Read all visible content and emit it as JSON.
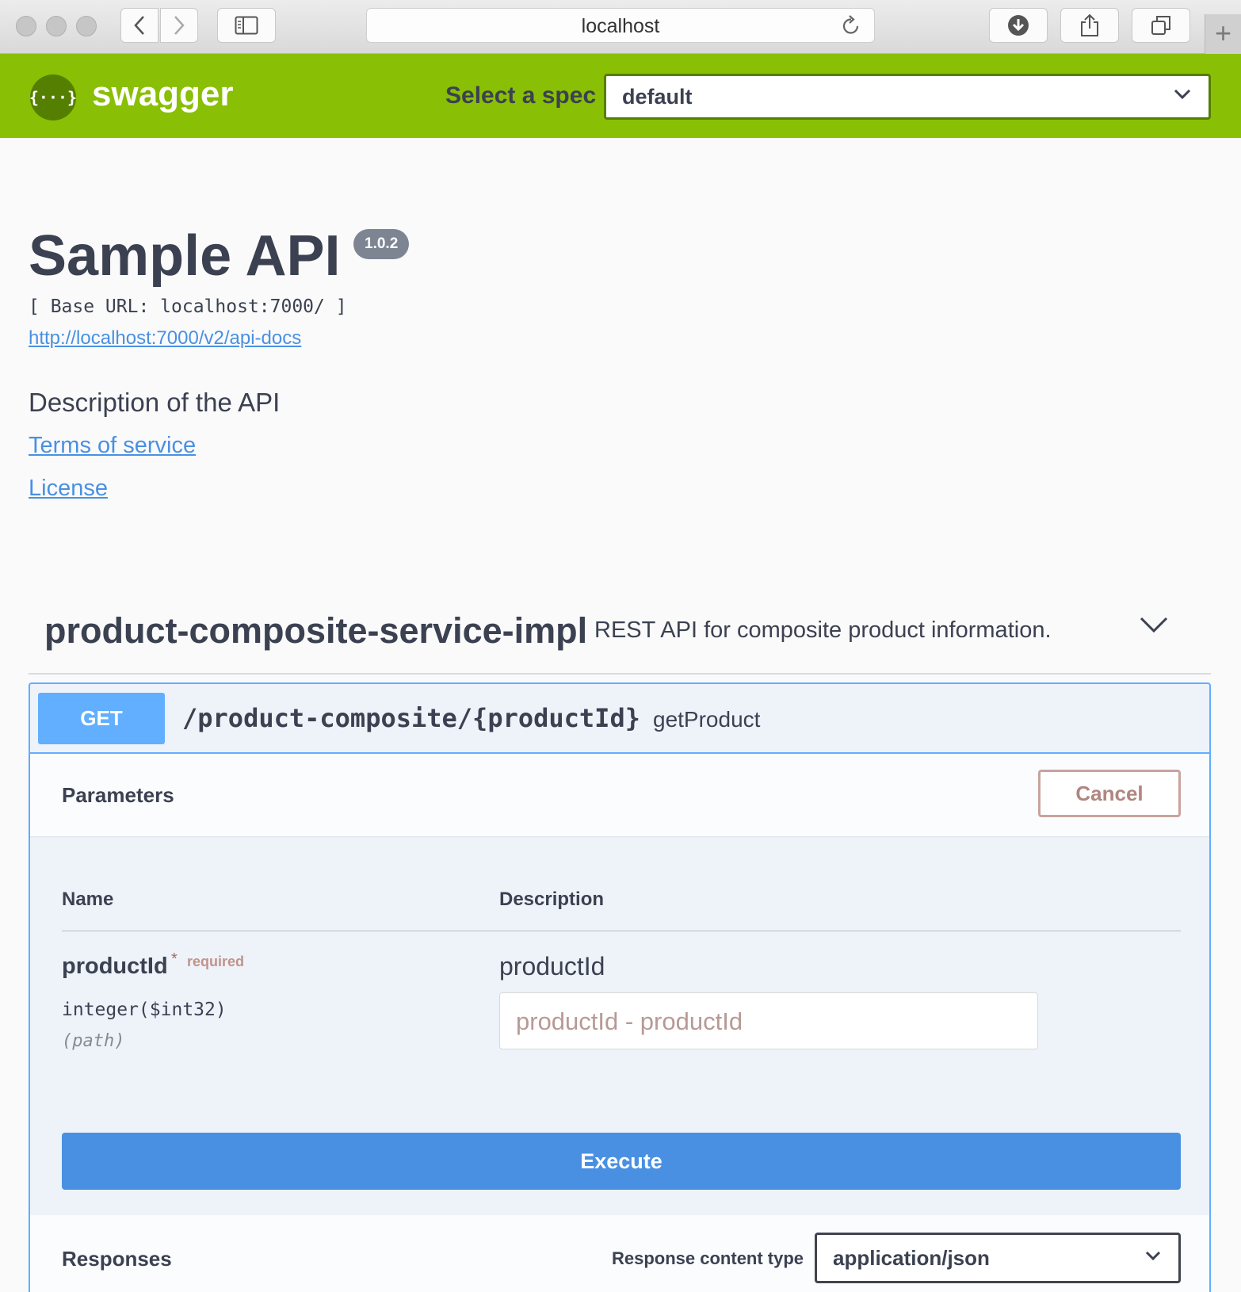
{
  "browser": {
    "url": "localhost"
  },
  "topbar": {
    "logo_symbol": "{···}",
    "logo_text": "swagger",
    "spec_label": "Select a spec",
    "spec_value": "default"
  },
  "info": {
    "title": "Sample API",
    "version": "1.0.2",
    "base_url": "[ Base URL: localhost:7000/ ]",
    "docs_link": "http://localhost:7000/v2/api-docs",
    "description": "Description of the API",
    "terms_link": "Terms of service",
    "license_link": "License"
  },
  "tag": {
    "name": "product-composite-service-impl",
    "description": "REST API for composite product information."
  },
  "operation": {
    "method": "GET",
    "path": "/product-composite/{productId}",
    "operation_id": "getProduct",
    "parameters_title": "Parameters",
    "cancel_label": "Cancel",
    "columns": {
      "name": "Name",
      "description": "Description"
    },
    "parameter": {
      "name": "productId",
      "required_star": "*",
      "required_label": "required",
      "type": "integer($int32)",
      "location": "(path)",
      "description": "productId",
      "placeholder": "productId - productId"
    },
    "execute_label": "Execute",
    "responses_title": "Responses",
    "response_content_type_label": "Response content type",
    "response_content_type_value": "application/json"
  },
  "colors": {
    "topbar": "#89bf04",
    "get_method": "#61affe",
    "execute": "#4990e2",
    "link": "#4990e2"
  }
}
